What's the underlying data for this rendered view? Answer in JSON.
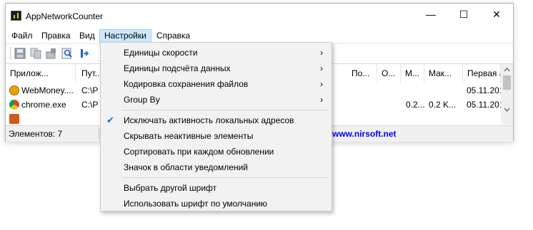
{
  "window": {
    "title": "AppNetworkCounter",
    "min": "—",
    "max": "☐",
    "close": "✕"
  },
  "menubar": [
    "Файл",
    "Правка",
    "Вид",
    "Настройки",
    "Справка"
  ],
  "toolbar": {
    "icons": [
      "save-icon",
      "copy-icon",
      "properties-icon",
      "find-icon",
      "exit-icon"
    ]
  },
  "columns": [
    "Прилож...",
    "Пут...",
    "По...",
    "О...",
    "М...",
    "Мак...",
    "Первая а"
  ],
  "rows": [
    {
      "name": "WebMoney....",
      "path": "C:\\P",
      "c4": "",
      "c5": "",
      "c6": "05.11.201"
    },
    {
      "name": "chrome.exe",
      "path": "C:\\P",
      "c4": "0.2...",
      "c5": "0.2 K...",
      "c6": "05.11.201"
    }
  ],
  "status": {
    "count": "Элементов: 7",
    "link": "www.nirsoft.net"
  },
  "settings_menu": {
    "items": [
      "Единицы скорости",
      "Единицы подсчёта данных",
      "Кодировка сохранения файлов",
      "Group By",
      "Исключать активность локальных адресов",
      "Скрывать неактивные элементы",
      "Сортировать при каждом обновлении",
      "Значок в области уведомлений",
      "Выбрать другой шрифт",
      "Использовать шрифт по умолчанию"
    ],
    "submenu_arrow": "›",
    "check": "✔"
  },
  "colors": {
    "accent": "#0078d7",
    "menu_highlight": "#cce8ff",
    "link": "#0000ff"
  }
}
